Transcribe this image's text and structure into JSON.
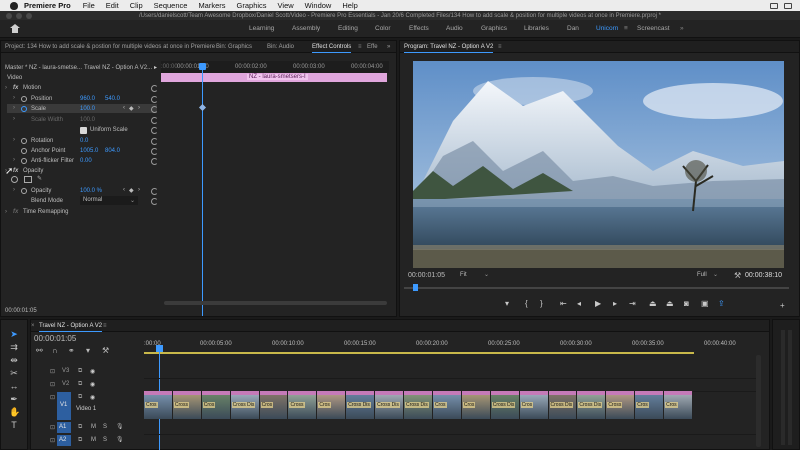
{
  "menubar": {
    "app": "Premiere Pro",
    "items": [
      "File",
      "Edit",
      "Clip",
      "Sequence",
      "Markers",
      "Graphics",
      "View",
      "Window",
      "Help"
    ]
  },
  "window_title": "/Users/danielscott/Team Awesome Dropbox/Daniel Scott/Video - Premiere Pro Essentials - Jan 20/6 Completed Files/134 How to add scale & position for multiple videos at once in Premiere.prproj *",
  "workspaces": [
    {
      "label": "Learning",
      "active": false
    },
    {
      "label": "Assembly",
      "active": false
    },
    {
      "label": "Editing",
      "active": false
    },
    {
      "label": "Color",
      "active": false
    },
    {
      "label": "Effects",
      "active": false
    },
    {
      "label": "Audio",
      "active": false
    },
    {
      "label": "Graphics",
      "active": false
    },
    {
      "label": "Libraries",
      "active": false
    },
    {
      "label": "Dan",
      "active": false
    },
    {
      "label": "Unicorn",
      "active": true
    },
    {
      "label": "Screencast",
      "active": false
    }
  ],
  "left_panel": {
    "tabs": [
      "Project: 134 How to add scale & postion for multiple videos at once in Premiere",
      "Bin: Graphics",
      "Bin: Audio",
      "Effect Controls",
      "Effe"
    ],
    "source": "Master * NZ - laura-smetse...",
    "sequence": "Travel NZ - Option A V2...",
    "ruler": [
      ":00:00",
      "00:00:01:00",
      "00:00:02:00",
      "00:00:03:00",
      "00:00:04:00"
    ],
    "clip_label": "NZ - laura-smetsers-I",
    "section_video": "Video",
    "motion": "Motion",
    "position_label": "Position",
    "position_x": "960.0",
    "position_y": "540.0",
    "scale_label": "Scale",
    "scale_value": "100.0",
    "scale_width_label": "Scale Width",
    "scale_width_value": "100.0",
    "uniform_scale": "Uniform Scale",
    "rotation_label": "Rotation",
    "rotation_value": "0.0",
    "anchor_label": "Anchor Point",
    "anchor_x": "1005.0",
    "anchor_y": "804.0",
    "antiflicker_label": "Anti-flicker Filter",
    "antiflicker_value": "0.00",
    "opacity_section": "Opacity",
    "opacity_label": "Opacity",
    "opacity_value": "100.0 %",
    "blend_label": "Blend Mode",
    "blend_value": "Normal",
    "time_remap": "Time Remapping",
    "timecode": "00:00:01:05"
  },
  "program_monitor": {
    "tab": "Program: Travel NZ - Option A V2",
    "timecode": "00:00:01:05",
    "fit": "Fit",
    "quality": "Full",
    "duration": "00:00:38:10"
  },
  "timeline": {
    "sequence_tab": "Travel NZ - Option A V2",
    "timecode": "00:00:01:05",
    "ruler": [
      ":00:00",
      "00:00:05:00",
      "00:00:10:00",
      "00:00:15:00",
      "00:00:20:00",
      "00:00:25:00",
      "00:00:30:00",
      "00:00:35:00",
      "00:00:40:00"
    ],
    "tracks": {
      "v3": "V3",
      "v2": "V2",
      "v1": "V1",
      "video1": "Video 1",
      "a1": "A1",
      "a2": "A2",
      "a1_src": "A1",
      "mute": "M",
      "solo": "S"
    },
    "clip_names": [
      "Cros",
      "Cross",
      "Cros",
      "Cross Dis",
      "Cros",
      "Cross",
      "Cros",
      "Cross Dis",
      "Cross Dis",
      "Cross Dis",
      "Cros",
      "Cros",
      "Cross Dis",
      "Cros",
      "Cross Dis",
      "Cross Dis",
      "Cross",
      "Cros",
      "Cros"
    ]
  },
  "colors": {
    "accent": "#3d9aff",
    "clip_pink": "#c57ab8",
    "workarea": "#c8b84a"
  }
}
